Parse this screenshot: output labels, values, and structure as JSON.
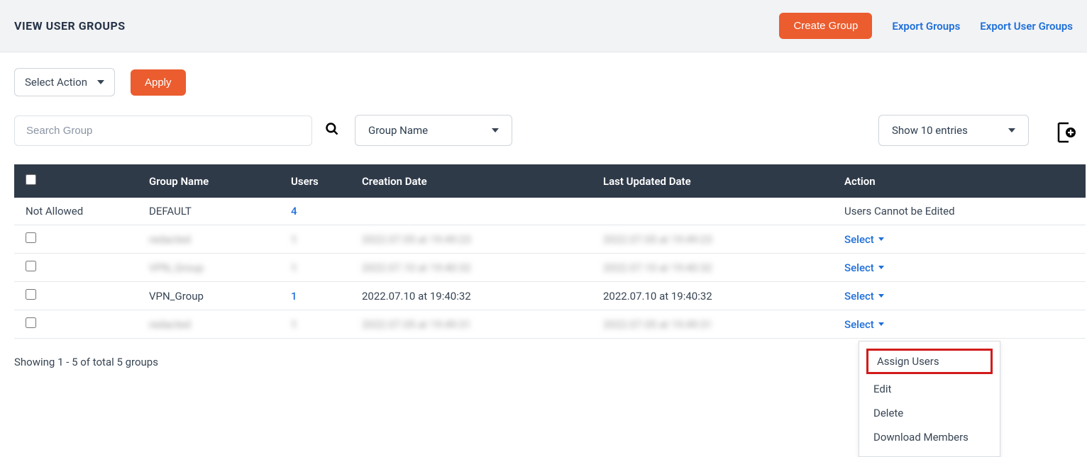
{
  "header": {
    "title": "VIEW USER GROUPS",
    "create_btn": "Create Group",
    "export_groups": "Export Groups",
    "export_user_groups": "Export User Groups"
  },
  "toolbar": {
    "select_action_label": "Select Action",
    "apply_label": "Apply"
  },
  "filters": {
    "search_placeholder": "Search Group",
    "group_name_label": "Group Name",
    "entries_label": "Show 10 entries"
  },
  "table": {
    "headers": {
      "name": "Group Name",
      "users": "Users",
      "created": "Creation Date",
      "updated": "Last Updated Date",
      "action": "Action"
    },
    "rows": [
      {
        "check_label": "Not Allowed",
        "is_checkbox": false,
        "name": "DEFAULT",
        "users": "4",
        "created": "",
        "updated": "",
        "action_text": "Users Cannot be Edited",
        "action_select": false,
        "blurred": false
      },
      {
        "check_label": "",
        "is_checkbox": true,
        "name": "redacted",
        "users": "1",
        "created": "2022.07.05 at 19:49:23",
        "updated": "2022.07.05 at 19:49:23",
        "action_text": "Select",
        "action_select": true,
        "blurred": true
      },
      {
        "check_label": "",
        "is_checkbox": true,
        "name": "VPN_Group",
        "users": "1",
        "created": "2022.07.10 at 19:40:32",
        "updated": "2022.07.10 at 19:40:32",
        "action_text": "Select",
        "action_select": true,
        "blurred": true
      },
      {
        "check_label": "",
        "is_checkbox": true,
        "name": "VPN_Group",
        "users": "1",
        "created": "2022.07.10 at 19:40:32",
        "updated": "2022.07.10 at 19:40:32",
        "action_text": "Select",
        "action_select": true,
        "blurred": false
      },
      {
        "check_label": "",
        "is_checkbox": true,
        "name": "redacted",
        "users": "1",
        "created": "2022.07.05 at 19:49:31",
        "updated": "2022.07.05 at 19:49:31",
        "action_text": "Select",
        "action_select": true,
        "blurred": true
      }
    ],
    "select_label": "Select"
  },
  "dropdown": {
    "assign": "Assign Users",
    "edit": "Edit",
    "delete": "Delete",
    "download": "Download Members"
  },
  "footer": {
    "summary": "Showing 1 - 5 of total 5 groups"
  }
}
